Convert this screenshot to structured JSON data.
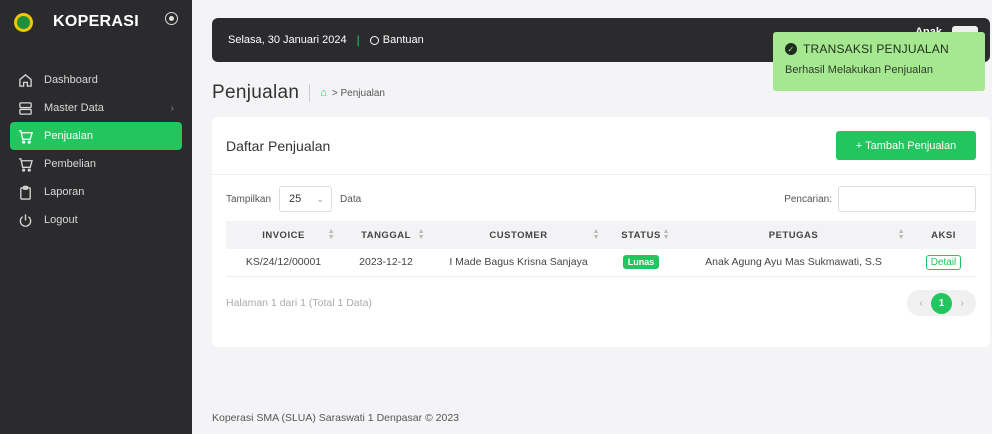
{
  "brand": {
    "name": "KOPERASI",
    "logo_icon": "school-logo-icon",
    "toggle_icon": "sidebar-toggle-icon"
  },
  "sidebar": {
    "items": [
      {
        "label": "Dashboard",
        "icon": "home-icon",
        "active": false
      },
      {
        "label": "Master Data",
        "icon": "database-icon",
        "active": false,
        "chevron": "›"
      },
      {
        "label": "Penjualan",
        "icon": "cart-icon",
        "active": true
      },
      {
        "label": "Pembelian",
        "icon": "cart-icon",
        "active": false
      },
      {
        "label": "Laporan",
        "icon": "clipboard-icon",
        "active": false
      },
      {
        "label": "Logout",
        "icon": "power-icon",
        "active": false
      }
    ]
  },
  "topbar": {
    "date": "Selasa, 30 Januari 2024",
    "separator": "|",
    "help_label": "Bantuan",
    "user_name": "Anak"
  },
  "toast": {
    "title": "TRANSAKSI PENJUALAN",
    "message": "Berhasil Melakukan Penjualan",
    "check": "✓"
  },
  "page": {
    "title": "Penjualan",
    "breadcrumb_home": "⌂",
    "breadcrumb_arrow": ">",
    "breadcrumb_current": "Penjualan"
  },
  "card": {
    "title": "Daftar Penjualan",
    "add_button": "+ Tambah Penjualan",
    "show_label": "Tampilkan",
    "page_size": "25",
    "select_chevron": "⌄",
    "data_label": "Data",
    "search_label": "Pencarian:",
    "search_value": ""
  },
  "table": {
    "headers": [
      "INVOICE",
      "TANGGAL",
      "CUSTOMER",
      "STATUS",
      "PETUGAS",
      "AKSI"
    ],
    "rows": [
      {
        "invoice": "KS/24/12/00001",
        "tanggal": "2023-12-12",
        "customer": "I Made Bagus Krisna Sanjaya",
        "status": "Lunas",
        "petugas": "Anak Agung Ayu Mas Sukmawati, S.S",
        "aksi": "Detail"
      }
    ]
  },
  "pagination": {
    "info": "Halaman 1 dari 1 (Total 1 Data)",
    "prev": "‹",
    "current": "1",
    "next": "›"
  },
  "footer": {
    "text": "Koperasi SMA (SLUA) Saraswati 1 Denpasar © 2023"
  },
  "colors": {
    "accent": "#22c55e",
    "sidebar_bg": "#2b2b2e",
    "toast_bg": "#a5e88f"
  }
}
